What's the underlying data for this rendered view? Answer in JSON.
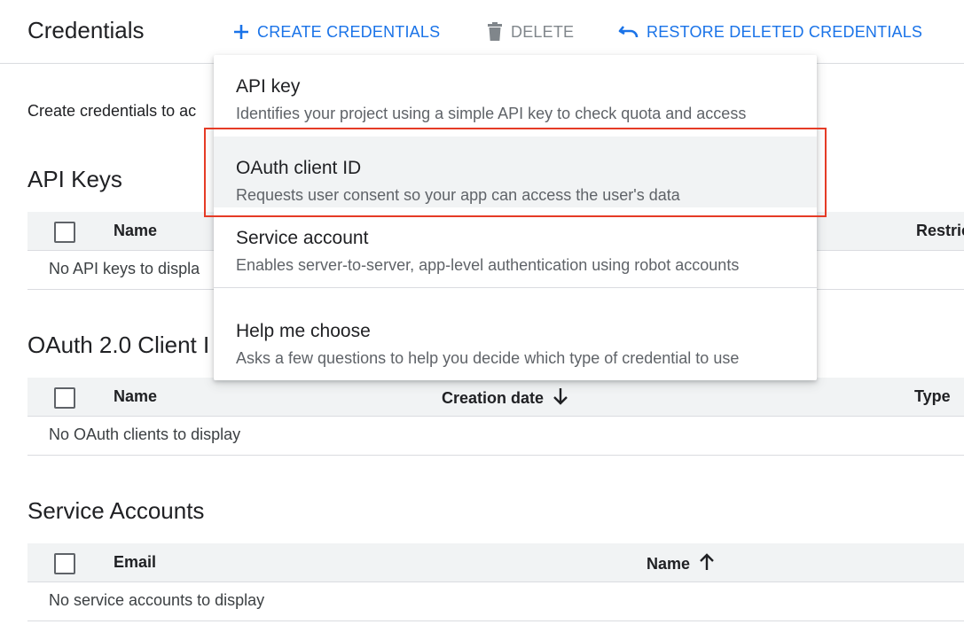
{
  "header": {
    "title": "Credentials",
    "create_label": "CREATE CREDENTIALS",
    "delete_label": "DELETE",
    "restore_label": "RESTORE DELETED CREDENTIALS"
  },
  "intro": "Create credentials to ac",
  "api_keys": {
    "title": "API Keys",
    "columns": [
      "Name",
      "Restric"
    ],
    "empty": "No API keys to displa"
  },
  "oauth": {
    "title": "OAuth 2.0 Client I",
    "columns": [
      "Name",
      "Creation date",
      "Type"
    ],
    "empty": "No OAuth clients to display"
  },
  "service_accounts": {
    "title": "Service Accounts",
    "columns": [
      "Email",
      "Name"
    ],
    "empty": "No service accounts to display"
  },
  "menu": {
    "items": [
      {
        "label": "API key",
        "desc": "Identifies your project using a simple API key to check quota and access"
      },
      {
        "label": "OAuth client ID",
        "desc": "Requests user consent so your app can access the user's data"
      },
      {
        "label": "Service account",
        "desc": "Enables server-to-server, app-level authentication using robot accounts"
      },
      {
        "label": "Help me choose",
        "desc": "Asks a few questions to help you decide which type of credential to use"
      }
    ]
  },
  "colors": {
    "accent": "#1a73e8",
    "disabled": "#80868b",
    "highlight_border": "#e53b26"
  },
  "icons": {
    "create": "plus-icon",
    "delete": "trash-icon",
    "restore": "undo-icon",
    "sort_desc": "arrow-down-icon",
    "sort_asc": "arrow-up-icon"
  }
}
